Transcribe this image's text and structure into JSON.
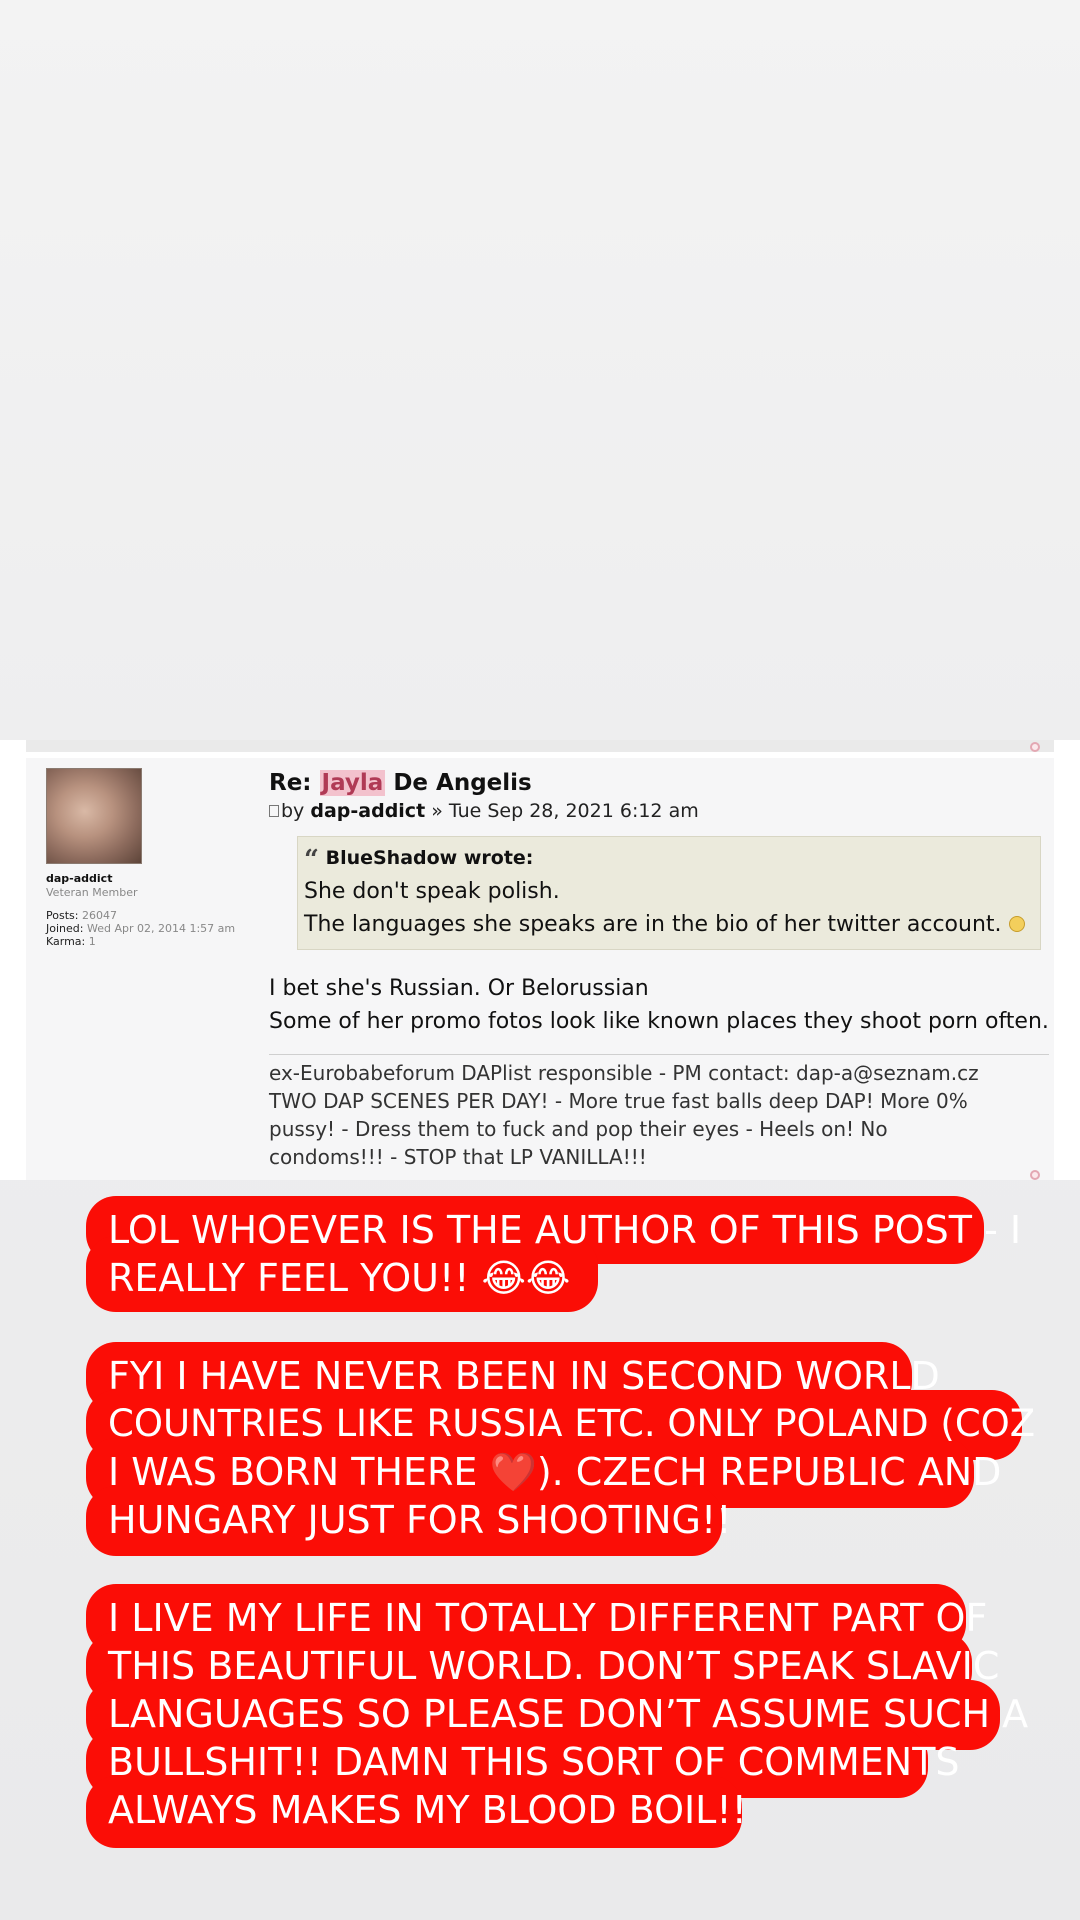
{
  "forum_post": {
    "title_prefix": "Re:",
    "title_highlight": "Jayla",
    "title_suffix": "De Angelis",
    "meta_by": "by",
    "meta_author": "dap-addict",
    "meta_date": "» Tue Sep 28, 2021 6:12 am",
    "author": {
      "username": "dap-addict",
      "rank": "Veteran Member",
      "posts_label": "Posts:",
      "posts_value": "26047",
      "joined_label": "Joined:",
      "joined_value": "Wed Apr 02, 2014 1:57 am",
      "karma_label": "Karma:",
      "karma_value": "1"
    },
    "quote": {
      "mark": "“",
      "author_line": "BlueShadow wrote:",
      "line1": "She don't speak polish.",
      "line2": "The languages she speaks are in the bio of her twitter account."
    },
    "body_line1": "I bet she's Russian. Or Belorussian",
    "body_line2": "Some of her promo fotos look like known places they shoot porn often.",
    "signature": {
      "line1": "ex-Eurobabeforum DAPlist responsible - PM contact: dap-a@seznam.cz",
      "line2": "TWO DAP SCENES PER DAY! - More true fast balls deep DAP! More 0%",
      "line3": "pussy! - Dress them to fuck and pop their eyes - Heels on! No",
      "line4": "condoms!!! - STOP that LP VANILLA!!!"
    }
  },
  "story_captions": {
    "caption1": {
      "line1": "LOL WHOEVER IS THE AUTHOR OF THIS POST - I",
      "line2": "REALLY FEEL YOU!! 😂😂"
    },
    "caption2": {
      "line1": "FYI I HAVE NEVER BEEN IN SECOND WORLD",
      "line2": "COUNTRIES LIKE RUSSIA ETC. ONLY POLAND (COZ",
      "line3a": "I WAS BORN THERE ",
      "heart": "❤️",
      "line3b": "). CZECH REPUBLIC AND",
      "line4": "HUNGARY JUST FOR SHOOTING!!"
    },
    "caption3": {
      "line1": "I LIVE MY LIFE IN TOTALLY DIFFERENT PART OF",
      "line2": "THIS BEAUTIFUL WORLD. DON’T SPEAK SLAVIC",
      "line3": "LANGUAGES SO PLEASE DON’T ASSUME SUCH A",
      "line4": "BULLSHIT!! DAMN THIS SORT OF COMMENTS",
      "line5": "ALWAYS MAKES MY BLOOD BOIL!!"
    }
  },
  "colors": {
    "caption_bg": "#fb0d06",
    "caption_text": "#ffffff",
    "title_highlight_bg": "#f3c2cd"
  }
}
